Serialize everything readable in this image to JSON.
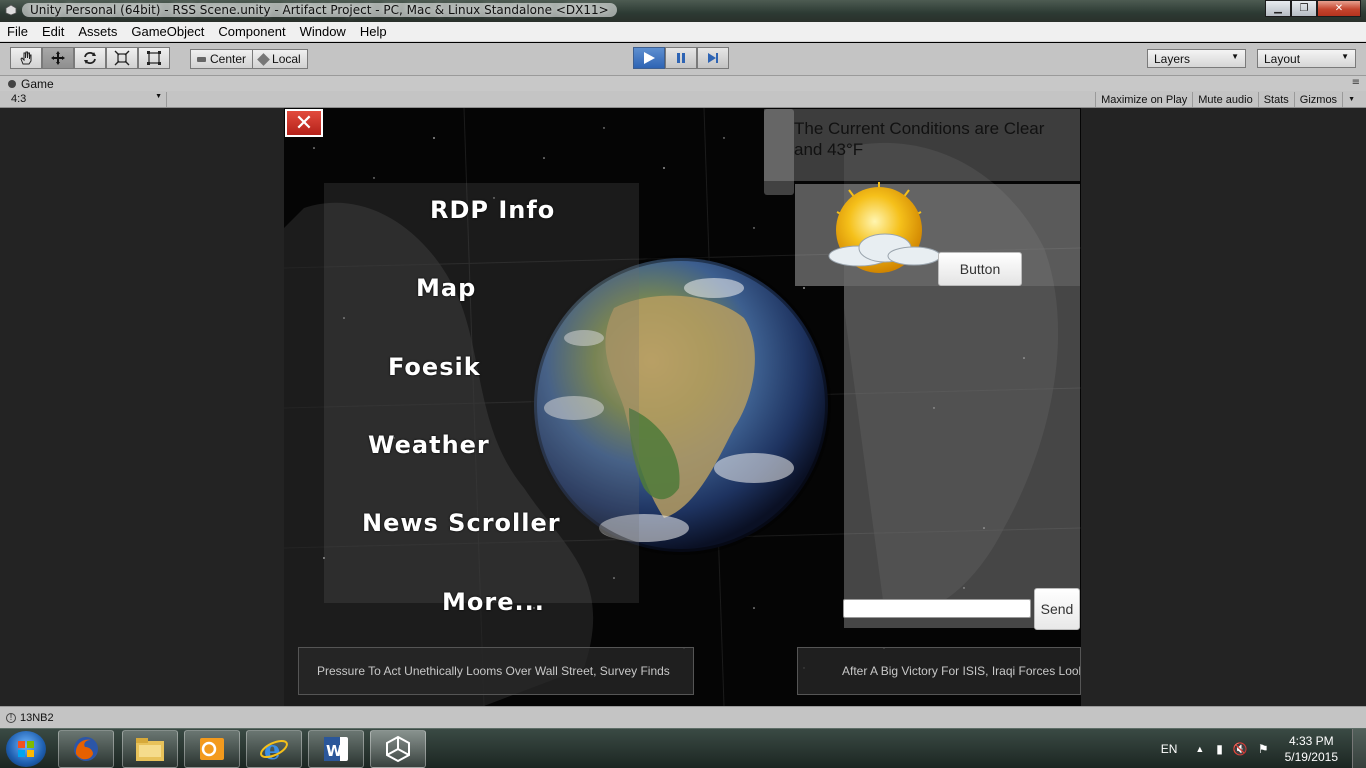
{
  "window": {
    "title": "Unity Personal (64bit) - RSS Scene.unity - Artifact Project - PC, Mac & Linux Standalone <DX11>"
  },
  "menubar": [
    "File",
    "Edit",
    "Assets",
    "GameObject",
    "Component",
    "Window",
    "Help"
  ],
  "toolbar": {
    "tools": [
      "hand-icon",
      "move-icon",
      "rotate-icon",
      "scale-icon",
      "rect-icon"
    ],
    "active_tool": "move-icon",
    "pivot_center": "Center",
    "pivot_local": "Local",
    "layers": "Layers",
    "layout": "Layout",
    "playing": true
  },
  "game_tab": {
    "label": "Game",
    "aspect": "4:3",
    "buttons": [
      "Maximize on Play",
      "Mute audio",
      "Stats",
      "Gizmos"
    ]
  },
  "game": {
    "menu_items": [
      "RDP Info",
      "Map",
      "Foesik",
      "Weather",
      "News Scroller",
      "More..."
    ],
    "weather_text": "The Current Conditions are Clear and 43°F",
    "weather_button": "Button",
    "send_button": "Send",
    "chat_input_value": "",
    "news": [
      "Pressure To Act Unethically Looms Over Wall Street, Survey Finds",
      "After A Big Victory For ISIS, Iraqi Forces Look"
    ]
  },
  "status": {
    "text": "13NB2"
  },
  "taskbar": {
    "apps": [
      "windows-start-icon",
      "firefox-icon",
      "file-explorer-icon",
      "outlook-icon",
      "internet-explorer-icon",
      "word-icon",
      "unity-icon"
    ],
    "language": "EN",
    "time": "4:33 PM",
    "date": "5/19/2015"
  },
  "colors": {
    "play_blue": "#2e64b4",
    "close_red": "#c5452e",
    "taskbar": "#24302b"
  }
}
